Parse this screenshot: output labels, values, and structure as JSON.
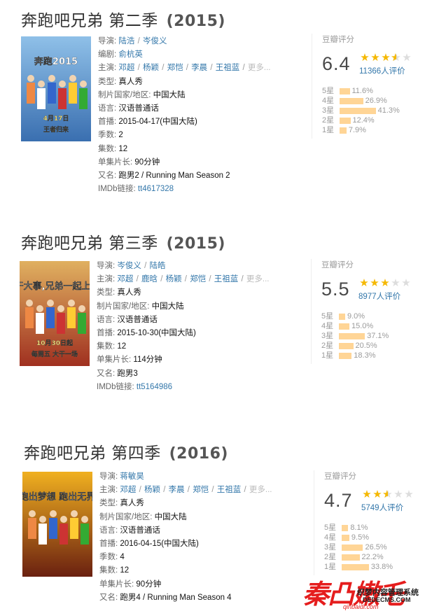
{
  "seasons": [
    {
      "title": "奔跑吧兄弟 第二季",
      "year": "(2015)",
      "director": [
        "陆浩",
        "岑俊义"
      ],
      "writer": [
        "俞杭英"
      ],
      "cast": [
        "邓超",
        "杨颖",
        "郑恺",
        "李晨",
        "王祖蓝"
      ],
      "more": "更多...",
      "genre": "真人秀",
      "country": "中国大陆",
      "language": "汉语普通话",
      "premiere": "2015-04-17(中国大陆)",
      "seasons_count": "2",
      "episodes": "12",
      "runtime": "90分钟",
      "aka": "跑男2 / Running Man Season 2",
      "imdb": "tt4617328",
      "score": "6.4",
      "stars": 3.5,
      "votes": "11366人评价",
      "dist": [
        11.6,
        26.9,
        41.3,
        12.4,
        7.9
      ],
      "dist_text": [
        "11.6%",
        "26.9%",
        "41.3%",
        "12.4%",
        "7.9%"
      ],
      "poster_text": [
        "奔跑2015",
        "4月17日",
        "王者归来"
      ],
      "poster_colors": [
        "#8fc0e8",
        "#3a6fb0"
      ]
    },
    {
      "title": "奔跑吧兄弟 第三季",
      "year": "(2015)",
      "director": [
        "岑俊义",
        "陆皓"
      ],
      "cast": [
        "邓超",
        "鹿晗",
        "杨颖",
        "郑恺",
        "王祖蓝"
      ],
      "more": "更多...",
      "genre": "真人秀",
      "country": "中国大陆",
      "language": "汉语普通话",
      "premiere": "2015-10-30(中国大陆)",
      "episodes": "12",
      "runtime": "114分钟",
      "aka": "跑男3",
      "imdb": "tt5164986",
      "score": "5.5",
      "stars": 3,
      "votes": "8977人评价",
      "dist": [
        9.0,
        15.0,
        37.1,
        20.5,
        18.3
      ],
      "dist_text": [
        "9.0%",
        "15.0%",
        "37.1%",
        "20.5%",
        "18.3%"
      ],
      "poster_text": [
        "干大事,兄弟一起上!",
        "10月30日起",
        "每周五 大干一场"
      ],
      "poster_colors": [
        "#e0b060",
        "#a03020"
      ]
    },
    {
      "title": "奔跑吧兄弟 第四季",
      "year": "(2016)",
      "director": [
        "蒋敏昊"
      ],
      "cast": [
        "邓超",
        "杨颖",
        "李晨",
        "郑恺",
        "王祖蓝"
      ],
      "more": "更多...",
      "genre": "真人秀",
      "country": "中国大陆",
      "language": "汉语普通话",
      "premiere": "2016-04-15(中国大陆)",
      "seasons_count": "4",
      "episodes": "12",
      "runtime": "90分钟",
      "aka": "跑男4 / Running Man Season 4",
      "score": "4.7",
      "stars": 2.5,
      "votes": "5749人评价",
      "dist": [
        8.1,
        9.5,
        26.5,
        22.2,
        33.8
      ],
      "dist_text": [
        "8.1%",
        "9.5%",
        "26.5%",
        "22.2%",
        "33.8%"
      ],
      "poster_text": [
        "跑出梦想 跑出无界"
      ],
      "poster_colors": [
        "#f0b020",
        "#6a2010"
      ]
    }
  ],
  "labels": {
    "director": "导演:",
    "writer": "编剧:",
    "cast": "主演:",
    "genre": "类型:",
    "country": "制片国家/地区:",
    "language": "语言:",
    "premiere": "首播:",
    "seasons_count": "季数:",
    "episodes": "集数:",
    "runtime": "单集片长:",
    "aka": "又名:",
    "imdb": "IMDb链接:",
    "rating": "豆瓣评分",
    "star_levels": [
      "5星",
      "4星",
      "3星",
      "2星",
      "1星"
    ]
  },
  "watermark": {
    "brand": "秦凸嫩乇",
    "line1": "织梦内容管理系统",
    "line2": "DEDECMS.COM",
    "line3": "qinbaidi.com"
  }
}
